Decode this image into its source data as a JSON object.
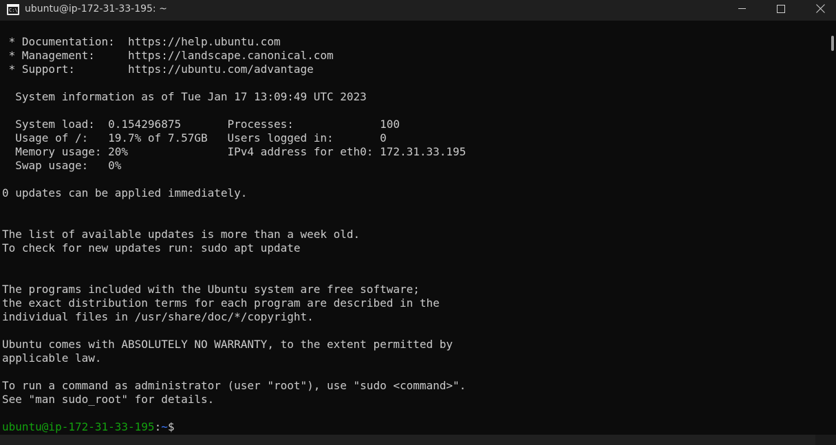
{
  "window": {
    "title": "ubuntu@ip-172-31-33-195: ~",
    "app_icon_text": "C:\\"
  },
  "terminal": {
    "lines": [
      " * Documentation:  https://help.ubuntu.com",
      " * Management:     https://landscape.canonical.com",
      " * Support:        https://ubuntu.com/advantage",
      "",
      "  System information as of Tue Jan 17 13:09:49 UTC 2023",
      "",
      "  System load:  0.154296875       Processes:             100",
      "  Usage of /:   19.7% of 7.57GB   Users logged in:       0",
      "  Memory usage: 20%               IPv4 address for eth0: 172.31.33.195",
      "  Swap usage:   0%",
      "",
      "0 updates can be applied immediately.",
      "",
      "",
      "The list of available updates is more than a week old.",
      "To check for new updates run: sudo apt update",
      "",
      "",
      "The programs included with the Ubuntu system are free software;",
      "the exact distribution terms for each program are described in the",
      "individual files in /usr/share/doc/*/copyright.",
      "",
      "Ubuntu comes with ABSOLUTELY NO WARRANTY, to the extent permitted by",
      "applicable law.",
      "",
      "To run a command as administrator (user \"root\"), use \"sudo <command>\".",
      "See \"man sudo_root\" for details.",
      ""
    ],
    "prompt": {
      "user_host": "ubuntu@ip-172-31-33-195",
      "separator": ":",
      "path": "~",
      "symbol": "$"
    }
  },
  "colors": {
    "background": "#0c0c0c",
    "text": "#cccccc",
    "prompt_user": "#13a10e",
    "prompt_path": "#3b78ff",
    "titlebar": "#1f1f1f"
  }
}
